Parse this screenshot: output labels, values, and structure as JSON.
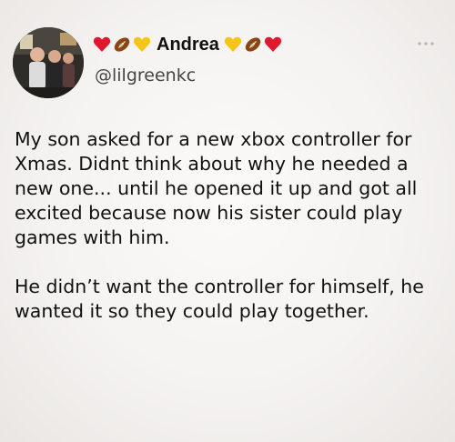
{
  "post": {
    "display_name": "Andrea",
    "handle": "@lilgreenkc",
    "name_emojis_before": [
      "red-heart-icon",
      "football-icon",
      "yellow-heart-icon"
    ],
    "name_emojis_after": [
      "yellow-heart-icon",
      "football-icon",
      "red-heart-icon"
    ],
    "paragraphs": [
      "My son asked for a new xbox controller for Xmas. Didnt think about why he needed a new one... until he opened it up and got all excited because now his sister could play games with him.",
      "He didn’t want the controller for himself, he wanted it so they could play together."
    ]
  },
  "colors": {
    "heart_red": "#e0182d",
    "heart_yellow": "#f5c518",
    "football_brown": "#8b4513"
  }
}
